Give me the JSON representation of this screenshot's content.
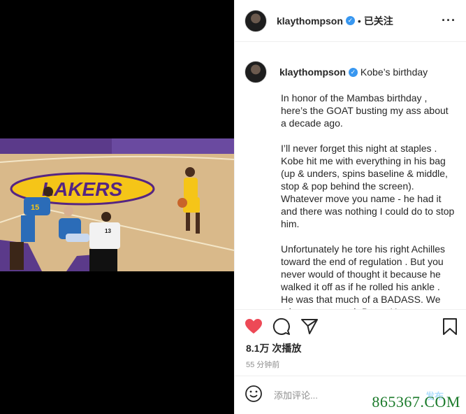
{
  "header": {
    "username": "klaythompson",
    "separator": "•",
    "follow_label": "已关注",
    "more_label": "···"
  },
  "caption": {
    "username": "klaythompson",
    "title": "Kobe’s birthday",
    "paragraphs": [
      "In honor of the Mambas birthday , here’s the GOAT busting my ass about a decade ago.",
      "I’ll never forget this night at staples . Kobe hit me with everything in his bag (up & unders, spins baseline & middle, stop & pop behind the screen). Whatever move you name - he had it and there was nothing I could do to stop him.",
      "Unfortunately he tore his right Achilles toward the end of regulation . But you never would of thought it because he walked it off as if he rolled his ankle . He was that much of a BADASS. We miss you so much Bean. Happy"
    ]
  },
  "stats": {
    "views": "8.1万 次播放",
    "time_ago": "55 分钟前"
  },
  "comment": {
    "placeholder": "添加评论...",
    "post_label": "发布"
  },
  "video": {
    "referee_number": "13",
    "player_number": "15"
  },
  "colors": {
    "like_red": "#ed4956",
    "verified_blue": "#3897f0",
    "post_blue": "#b2dffc",
    "lakers_gold": "#f5c518",
    "lakers_purple": "#552583"
  },
  "icons": {
    "like": "heart-filled-icon",
    "comment": "speech-bubble-icon",
    "share": "paper-plane-icon",
    "save": "bookmark-icon",
    "emoji": "smiley-icon",
    "verified": "verified-badge-icon",
    "more": "ellipsis-icon"
  },
  "watermark": "865367.COM"
}
